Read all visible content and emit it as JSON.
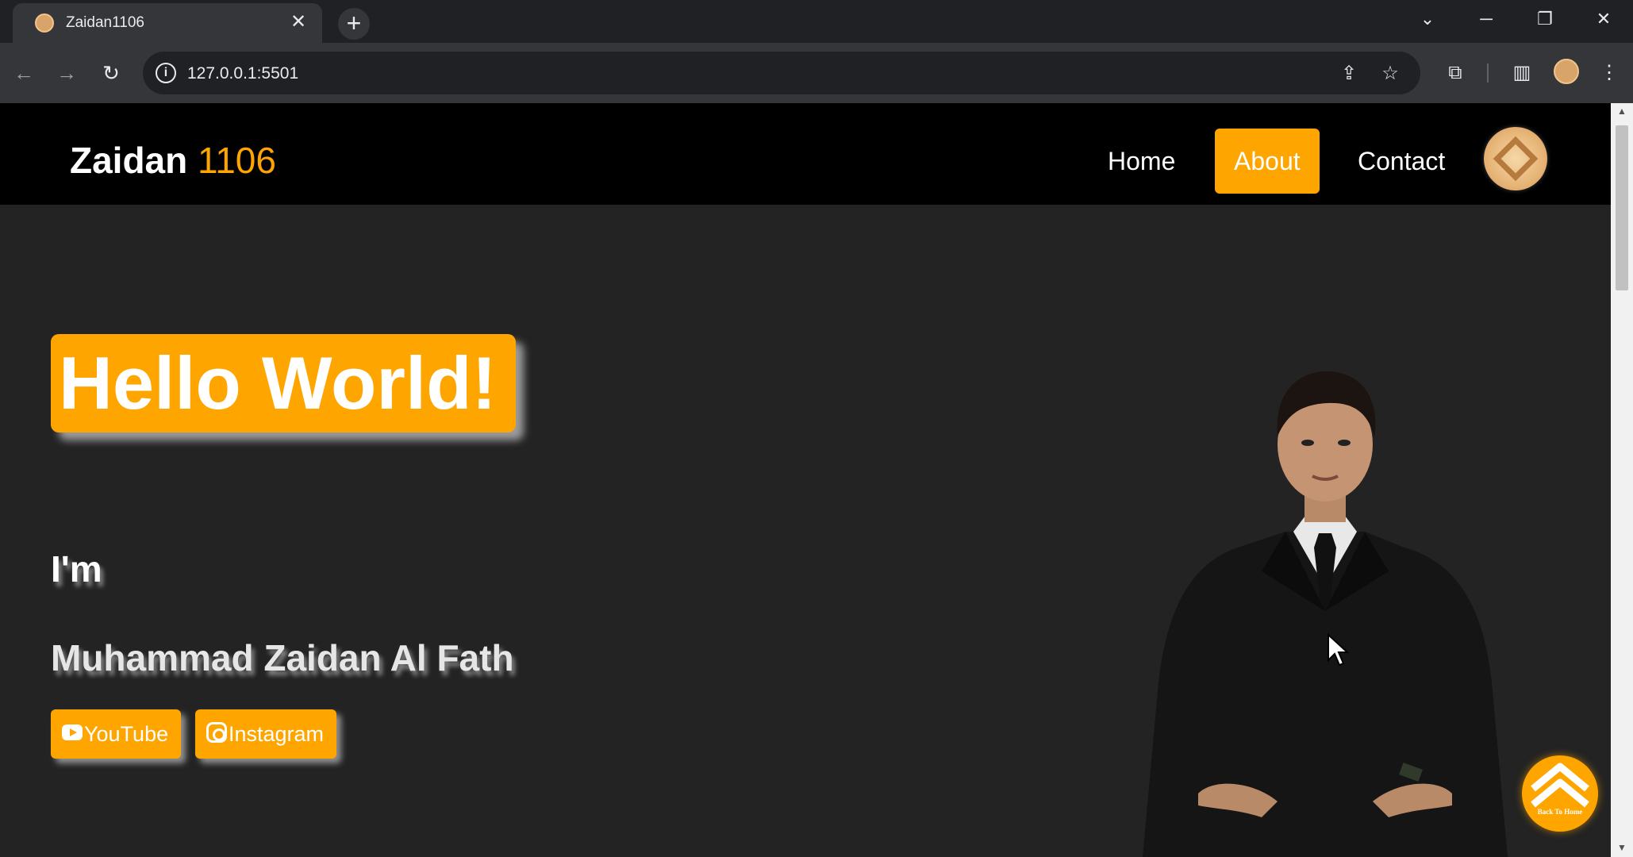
{
  "browser": {
    "tab_title": "Zaidan1106",
    "tab_close": "✕",
    "new_tab": "+",
    "url": "127.0.0.1:5501",
    "window_controls": {
      "tabs_menu": "⌄",
      "minimize": "─",
      "restore": "❐",
      "close": "✕"
    }
  },
  "site": {
    "brand_name": "Zaidan",
    "brand_number": "1106",
    "nav": {
      "home": "Home",
      "about": "About",
      "contact": "Contact"
    },
    "active_nav": "About",
    "accent_color": "#ffa500"
  },
  "hero": {
    "greeting": "Hello World!",
    "intro": "I'm",
    "full_name": "Muhammad Zaidan Al Fath",
    "youtube_label": "YouTube",
    "instagram_label": "Instagram"
  },
  "back_to_home": {
    "label": "Back To Home"
  },
  "icons": {
    "back": "←",
    "forward": "→",
    "reload": "↻",
    "share": "⇪",
    "star": "☆",
    "extensions": "⧉",
    "side_panel": "▥",
    "menu": "⋮"
  }
}
